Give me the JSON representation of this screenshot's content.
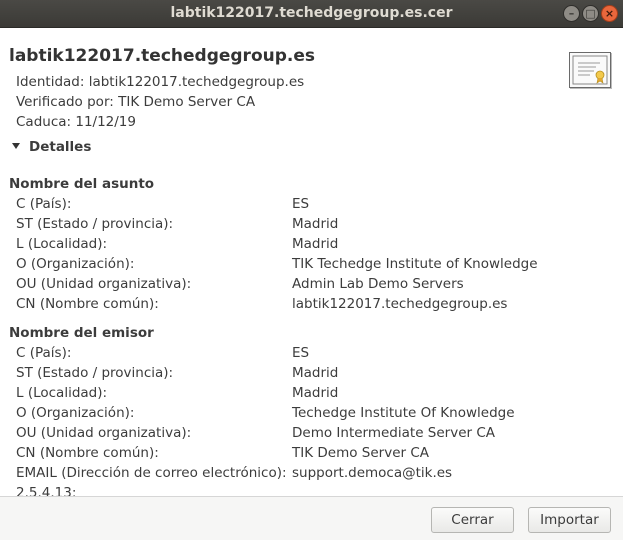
{
  "window": {
    "title": "labtik122017.techedgegroup.es.cer"
  },
  "header": {
    "title": "labtik122017.techedgegroup.es",
    "identity": "Identidad: labtik122017.techedgegroup.es",
    "verified_by": "Verificado por: TIK Demo Server CA",
    "expires": "Caduca: 11/12/19",
    "icon": "certificate-icon"
  },
  "details": {
    "label": "Detalles",
    "expanded": true
  },
  "subject": {
    "title": "Nombre del asunto",
    "rows": [
      {
        "label": "C (País):",
        "value": "ES"
      },
      {
        "label": "ST (Estado / provincia):",
        "value": "Madrid"
      },
      {
        "label": "L (Localidad):",
        "value": "Madrid"
      },
      {
        "label": "O (Organización):",
        "value": "TIK Techedge Institute of Knowledge"
      },
      {
        "label": "OU (Unidad organizativa):",
        "value": "Admin Lab Demo Servers"
      },
      {
        "label": "CN (Nombre común):",
        "value": "labtik122017.techedgegroup.es"
      }
    ]
  },
  "issuer": {
    "title": "Nombre del emisor",
    "rows": [
      {
        "label": "C (País):",
        "value": "ES"
      },
      {
        "label": "ST (Estado / provincia):",
        "value": "Madrid"
      },
      {
        "label": "L (Localidad):",
        "value": "Madrid"
      },
      {
        "label": "O (Organización):",
        "value": "Techedge Institute Of Knowledge"
      },
      {
        "label": "OU (Unidad organizativa):",
        "value": "Demo Intermediate Server CA"
      },
      {
        "label": "CN (Nombre común):",
        "value": "TIK Demo Server CA"
      },
      {
        "label": "EMAIL (Dirección de correo electrónico):",
        "value": "support.democa@tik.es"
      },
      {
        "label": "2.5.4.13:",
        "value": ""
      }
    ]
  },
  "buttons": {
    "cancel": "Cerrar",
    "import": "Importar"
  }
}
